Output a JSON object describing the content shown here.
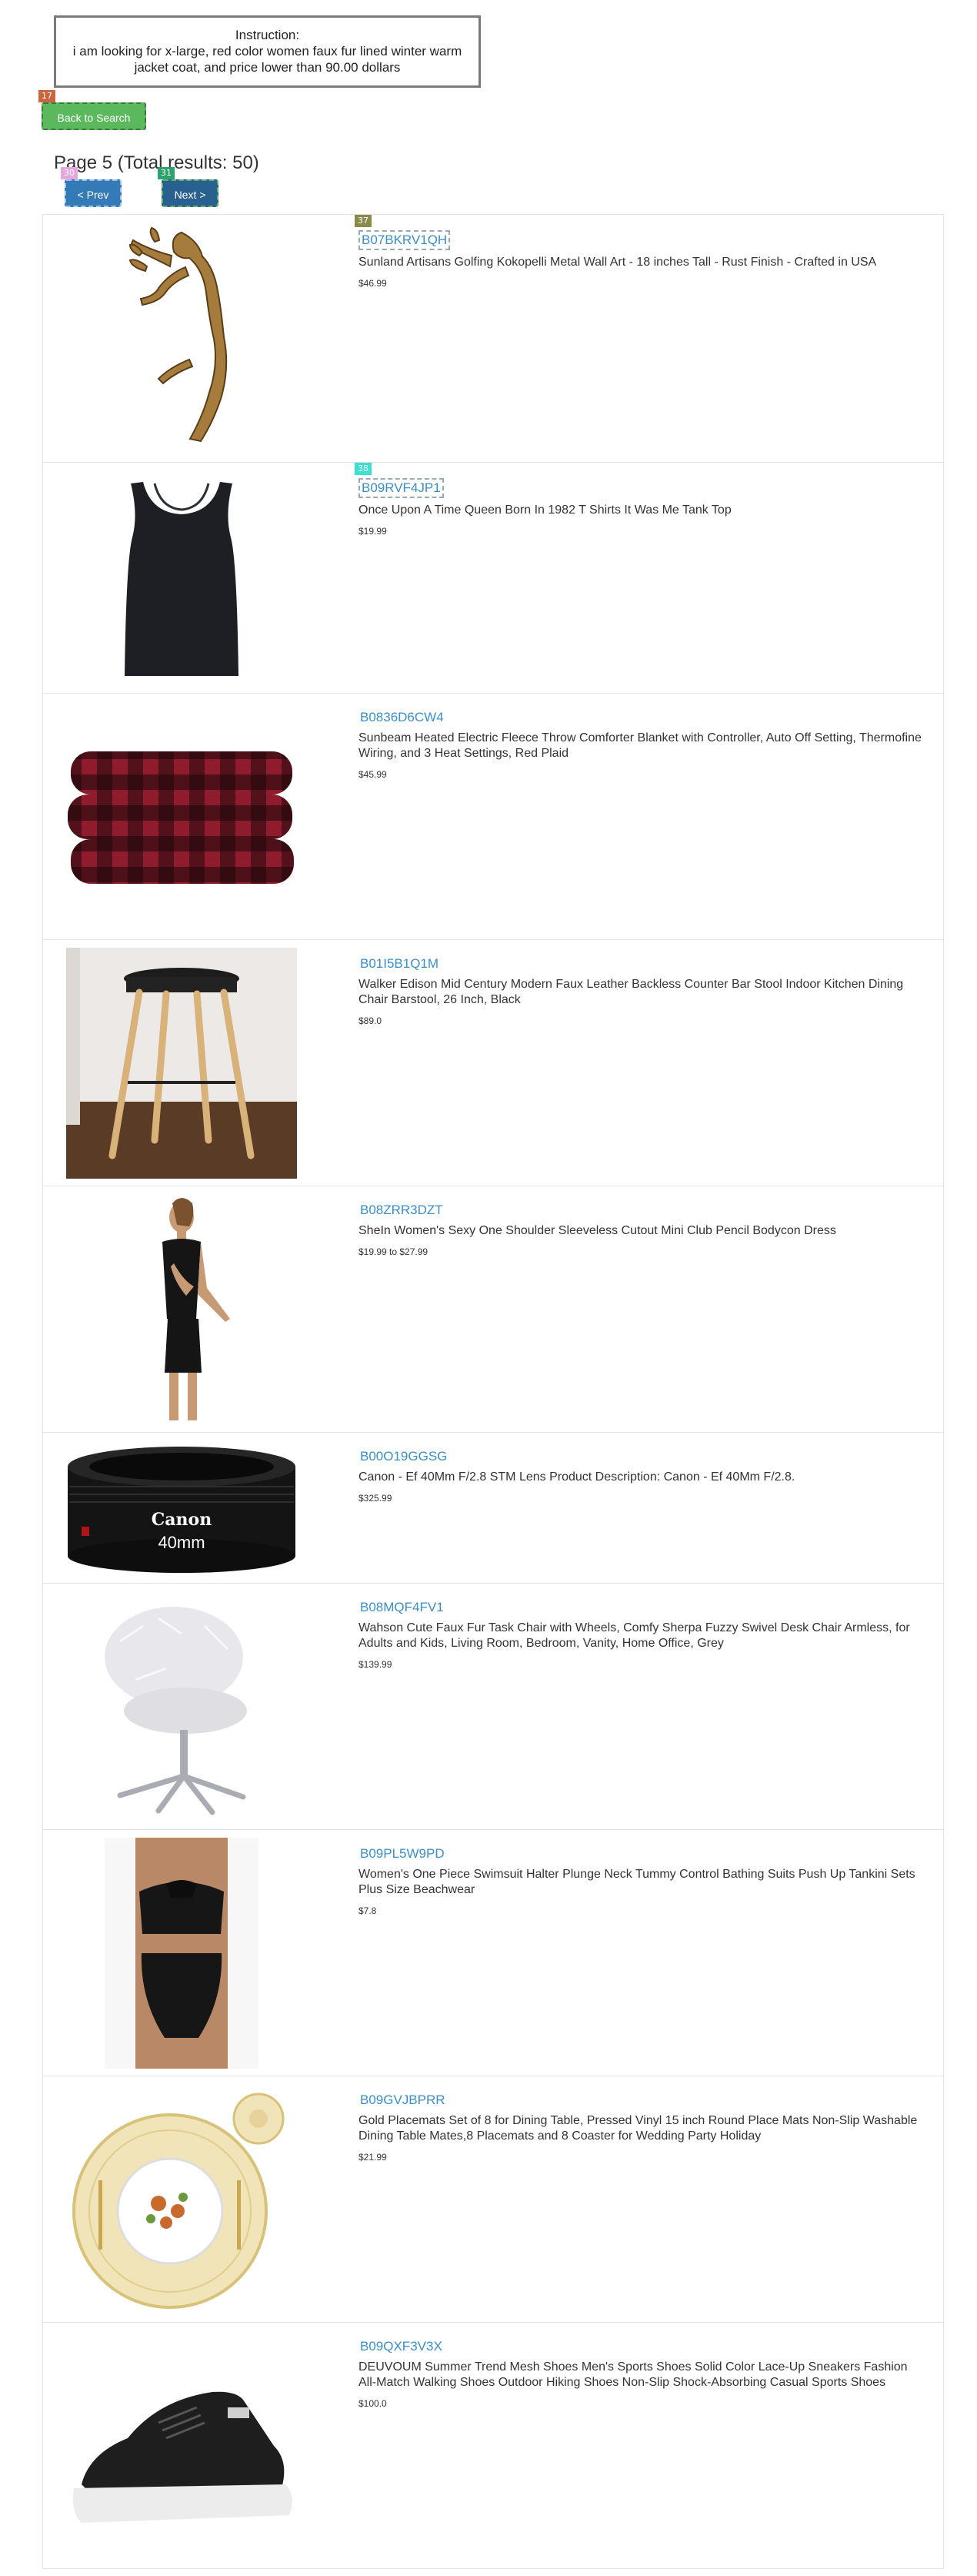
{
  "instruction": {
    "heading": "Instruction:",
    "text": "i am looking for x-large, red color women faux fur lined winter warm jacket coat, and price lower than 90.00 dollars"
  },
  "markers": {
    "back": "17",
    "prev": "30",
    "next": "31",
    "item1": "37",
    "item2": "38"
  },
  "back_button": "Back to Search",
  "page_title": "Page 5 (Total results: 50)",
  "prev_button": "< Prev",
  "next_button": "Next >",
  "products": [
    {
      "asin": "B07BKRV1QH",
      "title": "Sunland Artisans Golfing Kokopelli Metal Wall Art - 18 inches Tall - Rust Finish - Crafted in USA",
      "price": "$46.99",
      "image": "kokopelli-metal-art-image"
    },
    {
      "asin": "B09RVF4JP1",
      "title": "Once Upon A Time Queen Born In 1982 T Shirts It Was Me Tank Top",
      "price": "$19.99",
      "image": "black-tank-top-image"
    },
    {
      "asin": "B0836D6CW4",
      "title": "Sunbeam Heated Electric Fleece Throw Comforter Blanket with Controller, Auto Off Setting, Thermofine Wiring, and 3 Heat Settings, Red Plaid",
      "price": "$45.99",
      "image": "red-plaid-blanket-image"
    },
    {
      "asin": "B01I5B1Q1M",
      "title": "Walker Edison Mid Century Modern Faux Leather Backless Counter Bar Stool Indoor Kitchen Dining Chair Barstool, 26 Inch, Black",
      "price": "$89.0",
      "image": "bar-stool-image"
    },
    {
      "asin": "B08ZRR3DZT",
      "title": "SheIn Women's Sexy One Shoulder Sleeveless Cutout Mini Club Pencil Bodycon Dress",
      "price": "$19.99 to $27.99",
      "image": "black-dress-image"
    },
    {
      "asin": "B00O19GGSG",
      "title": "Canon - Ef 40Mm F/2.8 STM Lens Product Description: Canon - Ef 40Mm F/2.8.",
      "price": "$325.99",
      "image": "camera-lens-image",
      "lens_brand": "Canon",
      "lens_size": "40mm"
    },
    {
      "asin": "B08MQF4FV1",
      "title": "Wahson Cute Faux Fur Task Chair with Wheels, Comfy Sherpa Fuzzy Swivel Desk Chair Armless, for Adults and Kids, Living Room, Bedroom, Vanity, Home Office, Grey",
      "price": "$139.99",
      "image": "faux-fur-chair-image"
    },
    {
      "asin": "B09PL5W9PD",
      "title": "Women's One Piece Swimsuit Halter Plunge Neck Tummy Control Bathing Suits Push Up Tankini Sets Plus Size Beachwear",
      "price": "$7.8",
      "image": "black-swimsuit-image"
    },
    {
      "asin": "B09GVJBPRR",
      "title": "Gold Placemats Set of 8 for Dining Table, Pressed Vinyl 15 inch Round Place Mats Non-Slip Washable Dining Table Mates,8 Placemats and 8 Coaster for Wedding Party Holiday",
      "price": "$21.99",
      "image": "gold-placemat-image"
    },
    {
      "asin": "B09QXF3V3X",
      "title": "DEUVOUM Summer Trend Mesh Shoes Men's Sports Shoes Solid Color Lace-Up Sneakers Fashion All-Match Walking Shoes Outdoor Hiking Shoes Non-Slip Shock-Absorbing Casual Sports Shoes",
      "price": "$100.0",
      "image": "black-sneaker-image"
    }
  ]
}
